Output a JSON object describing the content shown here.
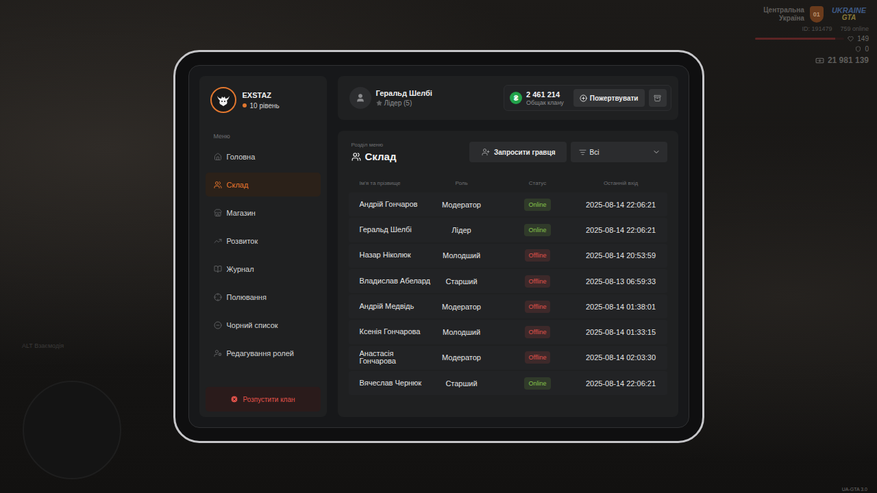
{
  "hud": {
    "region": "Центральна Україна",
    "region_badge": "01",
    "server_logo_top": "UKRAINE",
    "server_logo_bottom": "GTA",
    "player_id": "ID: 191479",
    "online": "759 online",
    "health": "149",
    "health_level": 0.9,
    "armor": "0",
    "money": "21 981 139",
    "interaction_hint": "ALT Взаємодія",
    "version": "UA-GTA 3.0"
  },
  "clan": {
    "name": "EXSTAZ",
    "level": "10 рівень"
  },
  "sidebar": {
    "label": "Меню",
    "items": [
      {
        "label": "Головна",
        "selected": false
      },
      {
        "label": "Склад",
        "selected": true
      },
      {
        "label": "Магазин",
        "selected": false
      },
      {
        "label": "Розвиток",
        "selected": false
      },
      {
        "label": "Журнал",
        "selected": false
      },
      {
        "label": "Полювання",
        "selected": false
      },
      {
        "label": "Чорний список",
        "selected": false
      },
      {
        "label": "Редагування ролей",
        "selected": false
      }
    ],
    "dissolve_button": "Розпустити клан"
  },
  "header": {
    "user_name": "Геральд Шелбі",
    "user_rank": "Лідер (5)",
    "coin_symbol": "₴",
    "bank_amount": "2 461 214",
    "bank_label": "Общак клану",
    "donate_button": "Пожертвувати"
  },
  "section": {
    "caption": "Розділ меню",
    "title": "Склад"
  },
  "actions": {
    "invite_button": "Запросити гравця",
    "filter_value": "Всі"
  },
  "table": {
    "columns": [
      "Ім'я та прізвище",
      "Роль",
      "Статус",
      "Останній вхід"
    ],
    "rows": [
      {
        "name": "Андрій Гончаров",
        "role": "Модератор",
        "status": "Online",
        "color": "#86c34a",
        "last_login": "2025-08-14 22:06:21"
      },
      {
        "name": "Геральд Шелбі",
        "role": "Лідер",
        "status": "Online",
        "color": "#86c34a",
        "last_login": "2025-08-14 22:06:21"
      },
      {
        "name": "Назар Ніколюк",
        "role": "Молодший",
        "status": "Offline",
        "color": "#e0524a",
        "last_login": "2025-08-14 20:53:59"
      },
      {
        "name": "Владислав Абелард",
        "role": "Старший",
        "status": "Offline",
        "color": "#e0524a",
        "last_login": "2025-08-13 06:59:33"
      },
      {
        "name": "Андрій Медвідь",
        "role": "Модератор",
        "status": "Offline",
        "color": "#e0524a",
        "last_login": "2025-08-14 01:38:01"
      },
      {
        "name": "Ксенія Гончарова",
        "role": "Молодший",
        "status": "Offline",
        "color": "#e0524a",
        "last_login": "2025-08-14 01:33:15"
      },
      {
        "name": "Анастасія Гончарова",
        "role": "Модератор",
        "status": "Offline",
        "color": "#e0524a",
        "last_login": "2025-08-14 02:03:30"
      },
      {
        "name": "Вячеслав Чернюк",
        "role": "Старший",
        "status": "Online",
        "color": "#86c34a",
        "last_login": "2025-08-14 22:06:21"
      }
    ]
  }
}
